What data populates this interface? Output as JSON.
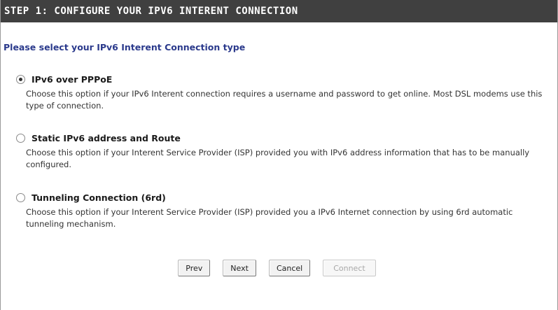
{
  "header": {
    "title": "STEP 1: CONFIGURE YOUR IPV6 INTERENT CONNECTION"
  },
  "prompt": "Please select your IPv6 Interent Connection type",
  "options": [
    {
      "label": "IPv6 over PPPoE",
      "description": "Choose this option if your IPv6 Interent connection requires a username and password to get online. Most DSL modems use this type of connection.",
      "selected": true
    },
    {
      "label": "Static IPv6 address and Route",
      "description": "Choose this option if your Interent Service Provider (ISP) provided you with IPv6 address information that has to be manually configured.",
      "selected": false
    },
    {
      "label": "Tunneling Connection (6rd)",
      "description": "Choose this option if your Interent Service Provider (ISP) provided you a IPv6 Internet connection by using 6rd automatic tunneling mechanism.",
      "selected": false
    }
  ],
  "buttons": {
    "prev": "Prev",
    "next": "Next",
    "cancel": "Cancel",
    "connect": "Connect"
  },
  "colors": {
    "header_bg": "#404040",
    "prompt_text": "#2b3a8c"
  }
}
